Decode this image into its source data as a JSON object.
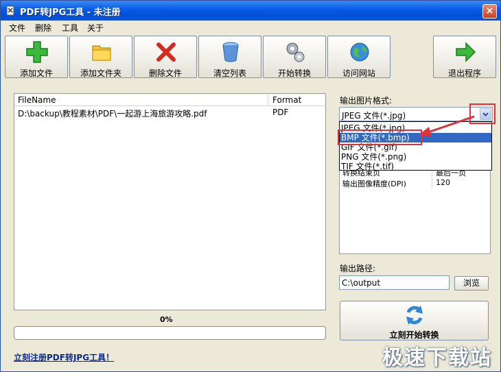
{
  "window": {
    "title": "PDF转JPG工具 - 未注册",
    "close": "×"
  },
  "menu": [
    "文件",
    "删除",
    "工具",
    "关于"
  ],
  "toolbar": {
    "add_file": "添加文件",
    "add_folder": "添加文件夹",
    "delete_file": "删除文件",
    "clear_list": "清空列表",
    "start_convert": "开始转换",
    "visit_site": "访问网站",
    "exit": "退出程序"
  },
  "file_list": {
    "columns": [
      "FileName",
      "Format"
    ],
    "rows": [
      {
        "name": "D:\\backup\\教程素材\\PDF\\一起游上海旅游攻略.pdf",
        "format": "PDF"
      }
    ]
  },
  "progress": {
    "label": "0%",
    "value": 0
  },
  "register_link": "立刻注册PDF转JPG工具！",
  "output_format": {
    "label": "输出图片格式:",
    "selected": "JPEG 文件(*.jpg)",
    "options": [
      "JPEG 文件(*.jpg)",
      "BMP 文件(*.bmp)",
      "GIF 文件(*.gif)",
      "PNG 文件(*.png)",
      "TIF 文件(*.tif)"
    ],
    "highlighted": "BMP 文件(*.bmp)"
  },
  "properties": [
    {
      "key": "转换结束页",
      "value": "最后一页"
    },
    {
      "key": "输出图像精度(DPI)",
      "value": "120"
    }
  ],
  "output_path": {
    "label": "输出路径:",
    "value": "C:\\output",
    "browse": "浏览"
  },
  "convert_now": "立刻开始转换",
  "watermark": "极速下载站",
  "colors": {
    "titlebar": "#0a5fe8",
    "highlight": "#316ac5",
    "annotation": "#e0303a"
  }
}
